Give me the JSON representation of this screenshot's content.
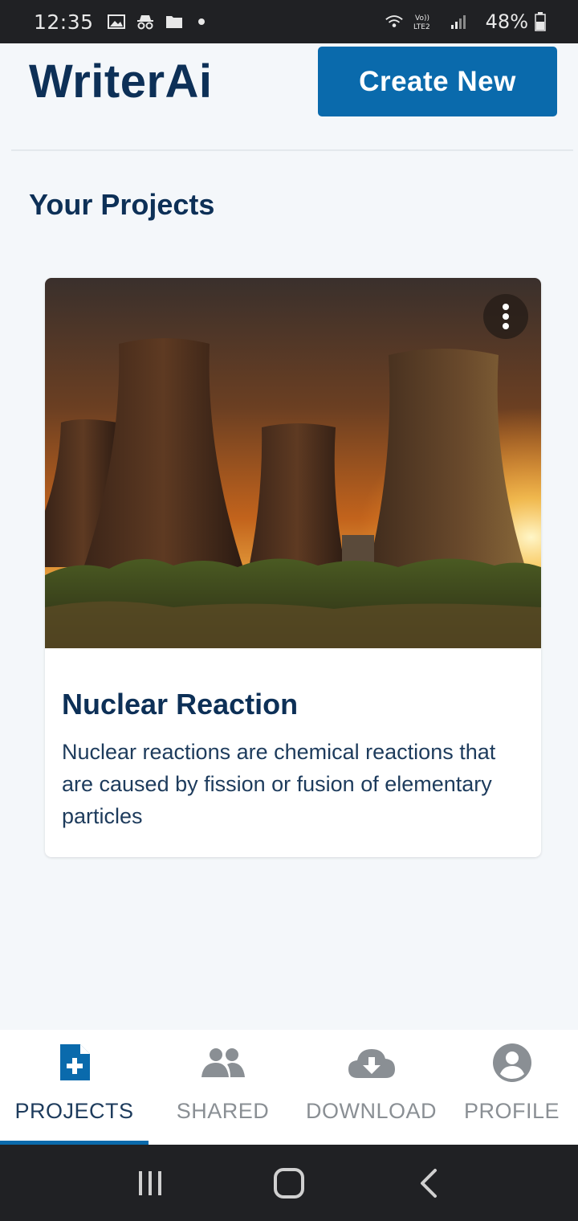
{
  "status_bar": {
    "time": "12:35",
    "battery_percent": "48%",
    "icons": [
      "image-icon",
      "incognito-icon",
      "folder-icon",
      "notification-dot",
      "wifi-icon",
      "volte-icon",
      "signal-icon",
      "battery-icon"
    ]
  },
  "header": {
    "app_title": "WriterAi",
    "create_button_label": "Create New"
  },
  "section_title": "Your Projects",
  "projects": [
    {
      "title": "Nuclear Reaction",
      "description": "Nuclear reactions are chemical reactions that are caused by fission or fusion of elementary particles",
      "image": "cooling-towers-sunset-photo"
    }
  ],
  "bottom_nav": {
    "items": [
      {
        "label": "PROJECTS",
        "icon": "file-plus-icon",
        "active": true
      },
      {
        "label": "SHARED",
        "icon": "users-icon",
        "active": false
      },
      {
        "label": "DOWNLOAD",
        "icon": "cloud-download-icon",
        "active": false
      },
      {
        "label": "PROFILE",
        "icon": "user-circle-icon",
        "active": false
      }
    ]
  },
  "colors": {
    "brand_dark": "#0d3057",
    "accent": "#0a6aac",
    "background": "#f4f7fa",
    "inactive": "#8a8f94"
  }
}
